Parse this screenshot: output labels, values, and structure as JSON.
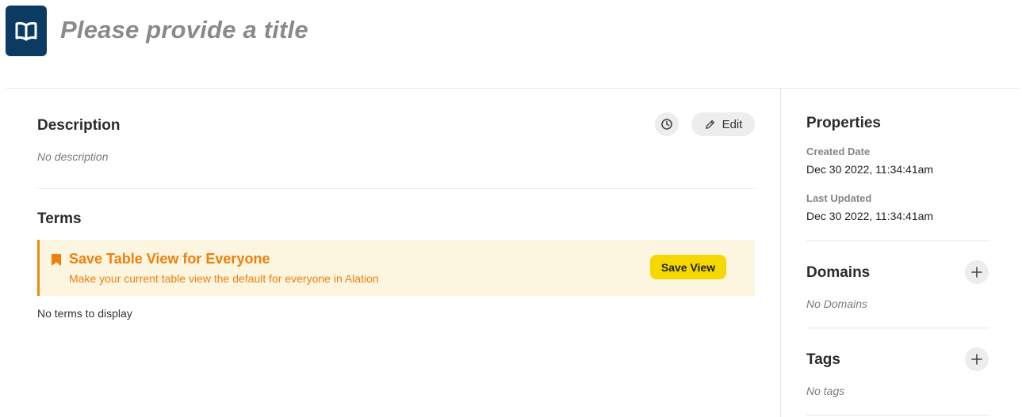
{
  "header": {
    "title": "Please provide a title",
    "icon": "open-book-icon",
    "icon_bg": "#0b3b63"
  },
  "description": {
    "heading": "Description",
    "empty_text": "No description",
    "edit_label": "Edit",
    "history_icon": "clock-icon",
    "edit_icon": "pencil-icon"
  },
  "terms": {
    "heading": "Terms",
    "empty_text": "No terms to display"
  },
  "banner": {
    "title": "Save Table View for Everyone",
    "subtitle": "Make your current table view the default for everyone in Alation",
    "button_label": "Save View",
    "icon": "bookmark-icon",
    "accent_color": "#ef7f0e",
    "button_color": "#f5d800"
  },
  "properties": {
    "heading": "Properties",
    "created_label": "Created Date",
    "created_value": "Dec 30 2022, 11:34:41am",
    "updated_label": "Last Updated",
    "updated_value": "Dec 30 2022, 11:34:41am"
  },
  "domains": {
    "heading": "Domains",
    "empty_text": "No Domains",
    "add_icon": "plus-icon"
  },
  "tags": {
    "heading": "Tags",
    "empty_text": "No tags",
    "add_icon": "plus-icon"
  }
}
